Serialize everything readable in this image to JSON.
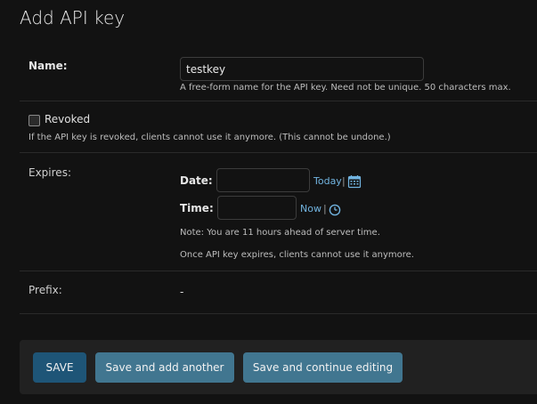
{
  "page": {
    "title": "Add API key"
  },
  "fields": {
    "name": {
      "label": "Name:",
      "value": "testkey",
      "help": "A free-form name for the API key. Need not be unique. 50 characters max."
    },
    "revoked": {
      "label": "Revoked",
      "checked": false,
      "help": "If the API key is revoked, clients cannot use it anymore. (This cannot be undone.)"
    },
    "expires": {
      "label": "Expires:",
      "date_label": "Date:",
      "date_value": "",
      "today_link": "Today",
      "separator": "|",
      "time_label": "Time:",
      "time_value": "",
      "now_link": "Now",
      "note": "Note: You are 11 hours ahead of server time.",
      "help": "Once API key expires, clients cannot use it anymore.",
      "calendar_icon": "calendar-icon",
      "clock_icon": "clock-icon"
    },
    "prefix": {
      "label": "Prefix:",
      "value": "-"
    }
  },
  "actions": {
    "save": "SAVE",
    "save_add_another": "Save and add another",
    "save_continue": "Save and continue editing"
  },
  "colors": {
    "accent_link": "#71b3df",
    "primary_button": "#1e5577",
    "secondary_button": "#417690",
    "background": "#121212"
  }
}
